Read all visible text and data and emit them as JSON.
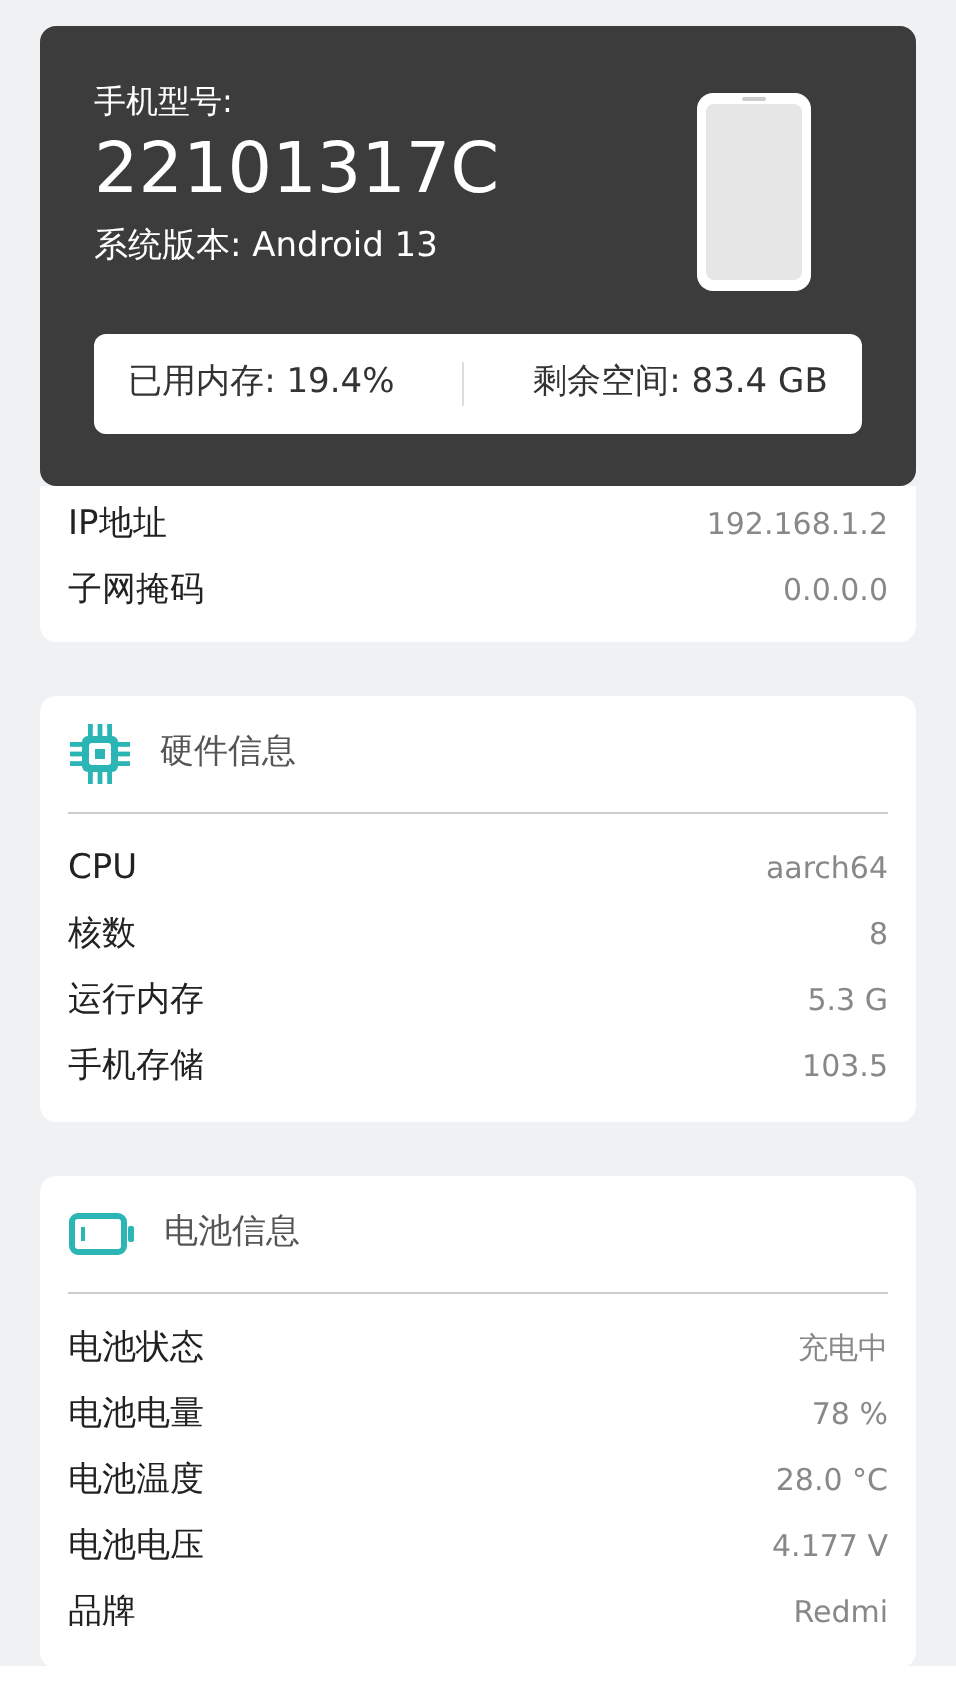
{
  "device": {
    "model_label": "手机型号:",
    "model": "22101317C",
    "version_label": "系统版本:",
    "version": "Android 13",
    "memory_label": "已用内存:",
    "memory": "19.4%",
    "storage_label": "剩余空间:",
    "storage": "83.4 GB"
  },
  "network": {
    "rows": [
      {
        "label": "IP地址",
        "value": "192.168.1.2"
      },
      {
        "label": "子网掩码",
        "value": "0.0.0.0"
      }
    ]
  },
  "sections": [
    {
      "kind": "chip",
      "title": "硬件信息",
      "rows": [
        {
          "label": "CPU",
          "value": "aarch64"
        },
        {
          "label": "核数",
          "value": "8"
        },
        {
          "label": "运行内存",
          "value": "5.3 G"
        },
        {
          "label": "手机存储",
          "value": "103.5"
        }
      ]
    },
    {
      "kind": "battery",
      "title": "电池信息",
      "rows": [
        {
          "label": "电池状态",
          "value": "充电中"
        },
        {
          "label": "电池电量",
          "value": "78 %"
        },
        {
          "label": "电池温度",
          "value": "28.0 °C"
        },
        {
          "label": "电池电压",
          "value": "4.177 V"
        },
        {
          "label": "品牌",
          "value": "Redmi"
        }
      ]
    }
  ]
}
